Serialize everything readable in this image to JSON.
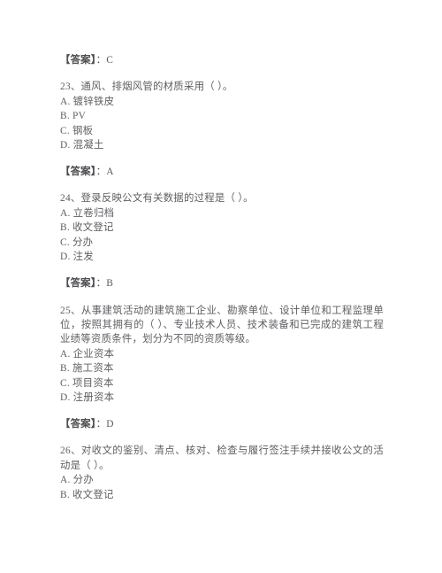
{
  "document": {
    "type": "exam-question-page",
    "language": "zh-CN",
    "text_color": "#5f5f63",
    "background_color": "#ffffff"
  },
  "blocks": [
    {
      "kind": "answer",
      "label": "【答案】",
      "separator": "：",
      "value": "C"
    },
    {
      "kind": "question",
      "number": "23",
      "stem": "23、通风、排烟风管的材质采用（    ）。",
      "options": [
        "A. 镀锌铁皮",
        "B. PV",
        "C. 钢板",
        "D. 混凝土"
      ]
    },
    {
      "kind": "answer",
      "label": "【答案】",
      "separator": "：",
      "value": "A"
    },
    {
      "kind": "question",
      "number": "24",
      "stem": "24、登录反映公文有关数据的过程是（    ）。",
      "options": [
        "A. 立卷归档",
        "B. 收文登记",
        "C. 分办",
        "D. 注发"
      ]
    },
    {
      "kind": "answer",
      "label": "【答案】",
      "separator": "：",
      "value": "B"
    },
    {
      "kind": "question",
      "number": "25",
      "stem": "25、从事建筑活动的建筑施工企业、勘察单位、设计单位和工程监理单位，按照其拥有的（    ）、专业技术人员、技术装备和已完成的建筑工程业绩等资质条件，划分为不同的资质等级。",
      "options": [
        "A. 企业资本",
        "B. 施工资本",
        "C. 项目资本",
        "D. 注册资本"
      ]
    },
    {
      "kind": "answer",
      "label": "【答案】",
      "separator": "：",
      "value": "D"
    },
    {
      "kind": "question",
      "number": "26",
      "stem": "26、对收文的鉴别、清点、核对、检查与履行签注手续并接收公文的活动是（    ）。",
      "options": [
        "A. 分办",
        "B. 收文登记"
      ]
    }
  ]
}
